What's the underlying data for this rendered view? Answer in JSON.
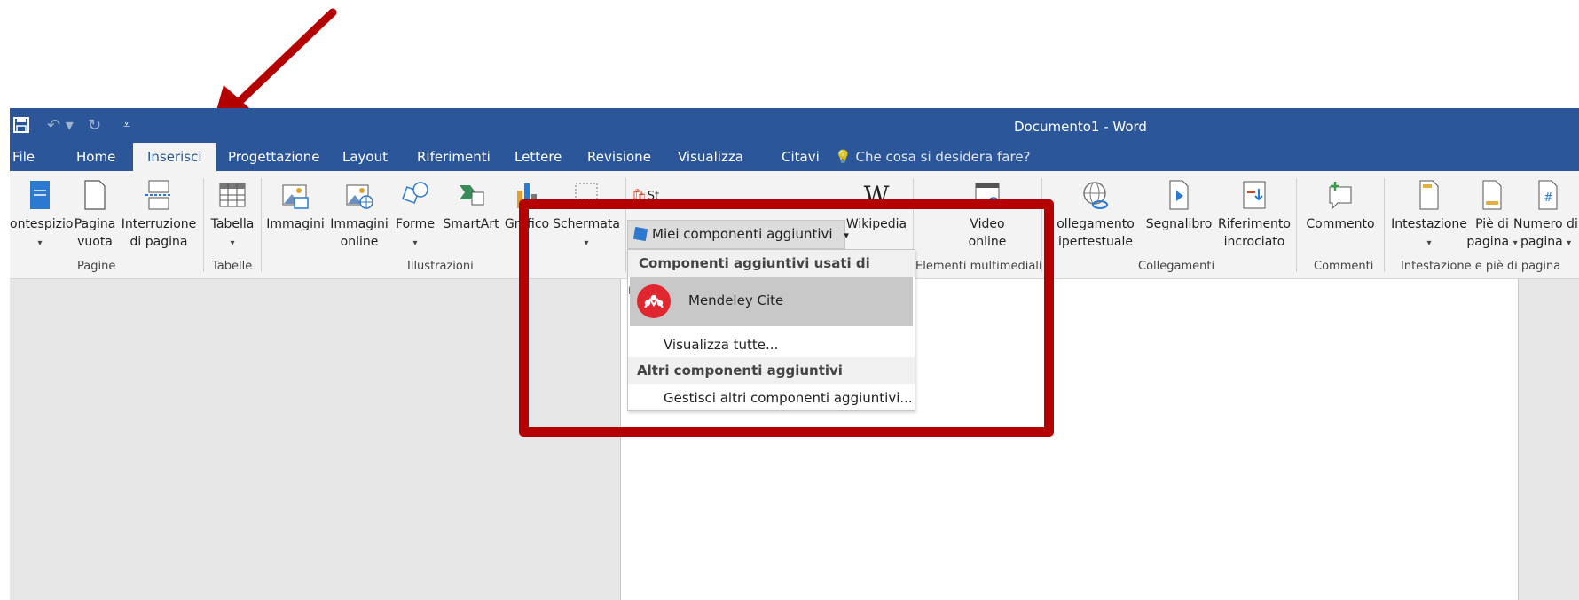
{
  "window": {
    "title": "Documento1 - Word"
  },
  "quick_access": {
    "save_icon": "save-icon",
    "undo_icon": "undo-icon",
    "redo_icon": "redo-icon",
    "customize_icon": "customize-icon"
  },
  "tabs": [
    {
      "label": "File"
    },
    {
      "label": "Home"
    },
    {
      "label": "Inserisci",
      "active": true
    },
    {
      "label": "Progettazione"
    },
    {
      "label": "Layout"
    },
    {
      "label": "Riferimenti"
    },
    {
      "label": "Lettere"
    },
    {
      "label": "Revisione"
    },
    {
      "label": "Visualizza"
    },
    {
      "label": "Citavi"
    }
  ],
  "tell_me": {
    "text": "Che cosa si desidera fare?"
  },
  "ribbon": {
    "pagine": {
      "label": "Pagine",
      "frontespizio": "ontespizio",
      "pagina_vuota_1": "Pagina",
      "pagina_vuota_2": "vuota",
      "interruzione_1": "Interruzione",
      "interruzione_2": "di pagina"
    },
    "tabelle": {
      "label": "Tabelle",
      "tabella": "Tabella"
    },
    "illustrazioni": {
      "label": "Illustrazioni",
      "immagini": "Immagini",
      "immagini_online_1": "Immagini",
      "immagini_online_2": "online",
      "forme": "Forme",
      "smartart": "SmartArt",
      "grafico": "Grafico",
      "schermata": "Schermata"
    },
    "addins": {
      "store_partial": "St",
      "miei_componenti": "Miei componenti aggiuntivi",
      "wikipedia": "Wikipedia"
    },
    "multimedia": {
      "label": "Elementi multimediali",
      "video_1": "Video",
      "video_2": "online"
    },
    "collegamenti": {
      "label": "Collegamenti",
      "collegamento_1": "ollegamento",
      "collegamento_2": "ipertestuale",
      "segnalibro": "Segnalibro",
      "riferimento_1": "Riferimento",
      "riferimento_2": "incrociato"
    },
    "commenti": {
      "label": "Commenti",
      "commento": "Commento"
    },
    "intestazione": {
      "label": "Intestazione e piè di pagina",
      "intestazione": "Intestazione",
      "pie_1": "Piè di",
      "pie_2": "pagina",
      "numero_1": "Numero di",
      "numero_2": "pagina"
    }
  },
  "dropdown": {
    "recent_header": "Componenti aggiuntivi usati di recente",
    "mendeley": "Mendeley Cite",
    "view_all": "Visualizza tutte...",
    "other_header": "Altri componenti aggiuntivi",
    "manage": "Gestisci altri componenti aggiuntivi..."
  },
  "colors": {
    "word_blue": "#2b579a",
    "annotation_red": "#b40000",
    "mendeley_red": "#e0262e"
  }
}
